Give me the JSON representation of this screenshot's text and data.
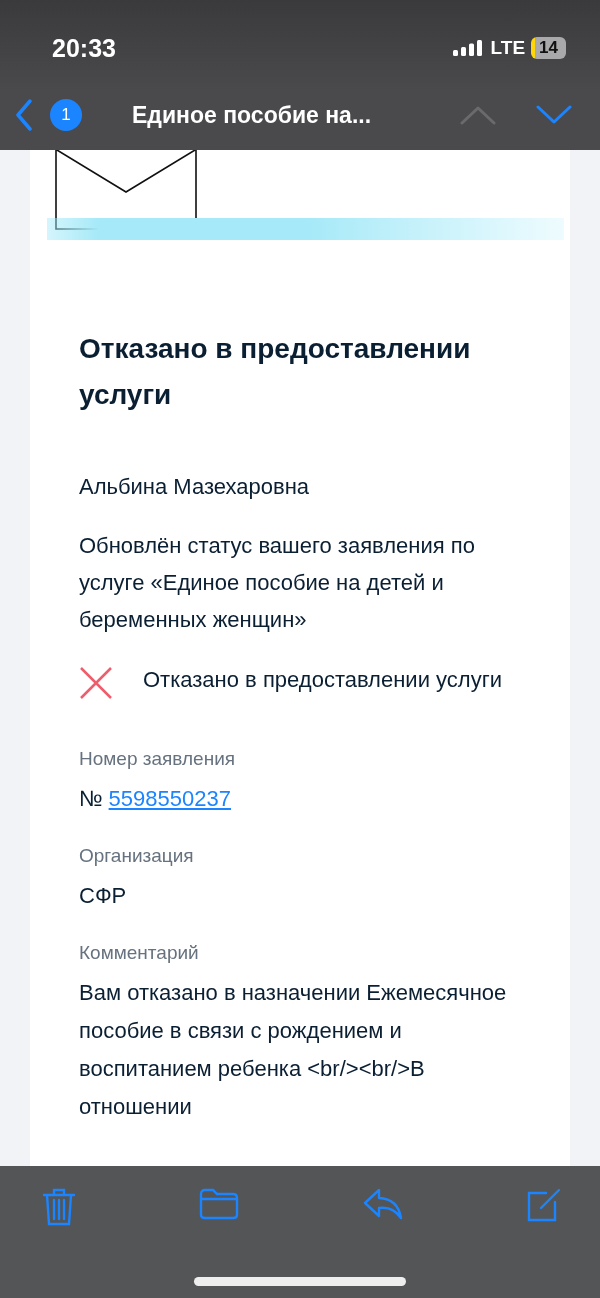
{
  "status_bar": {
    "time": "20:33",
    "network": "LTE",
    "battery": "14"
  },
  "nav": {
    "unread_count": "1",
    "title": "Единое пособие на...",
    "prev_disabled": true,
    "next_disabled": false
  },
  "message": {
    "title": "Отказано в предоставлении услуги",
    "greeting": "Альбина Мазехаровна",
    "body": "Обновлён статус вашего заявления по услуге «Единое пособие на детей и беременных женщин»",
    "status": {
      "kind": "rejected",
      "text": "Отказано в предоставлении услуги"
    },
    "fields": [
      {
        "kind": "link",
        "label": "Номер заявления",
        "prefix": "№",
        "value": "5598550237"
      },
      {
        "kind": "text",
        "label": "Организация",
        "value": "СФР"
      },
      {
        "kind": "text",
        "label": "Комментарий",
        "value": "Вам отказано в назначении Ежемесячное пособие в связи с рождением и воспитанием ребенка <br/><br/>В отношении"
      }
    ]
  }
}
